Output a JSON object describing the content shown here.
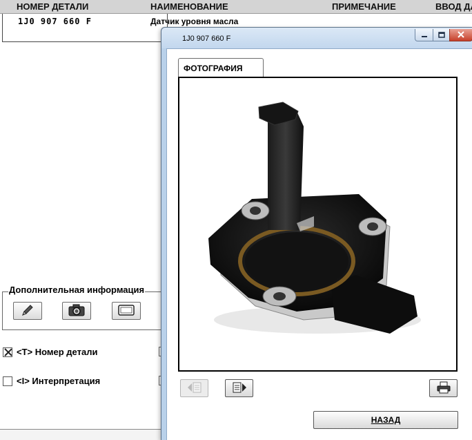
{
  "table": {
    "headers": [
      "НОМЕР ДЕТАЛИ",
      "НАИМЕНОВАНИЕ",
      "ПРИМЕЧАНИЕ",
      "ВВОД ДА"
    ],
    "rows": [
      {
        "part_number": "1J0 907 660 F",
        "name": "Датчик уровня масла"
      }
    ]
  },
  "additional_info": {
    "title": "Дополнительная информация",
    "buttons": [
      "pencil-icon",
      "camera-icon",
      "frame-icon"
    ]
  },
  "options": [
    {
      "label": "<T> Номер детали",
      "checked": true
    },
    {
      "label": "<I> Интерпретация",
      "checked": false
    }
  ],
  "dialog": {
    "title": "1J0 907 660 F",
    "tab_label": "ФОТОГРАФИЯ",
    "photo": "oil-level-sensor-photo",
    "nav": {
      "prev_enabled": false,
      "next_enabled": true,
      "print_icon": "printer-icon"
    },
    "back_label": "НАЗАД"
  },
  "colors": {
    "window_frame": "#b9d1ea",
    "header_bg": "#d4d4d4",
    "close_button": "#c7402a"
  }
}
